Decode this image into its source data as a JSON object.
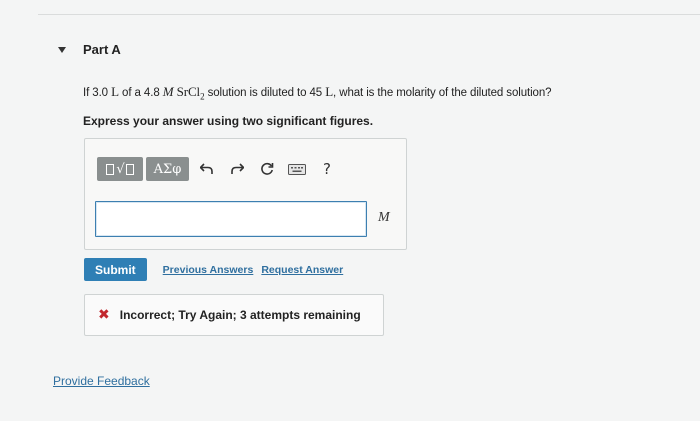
{
  "part": {
    "title": "Part A"
  },
  "question": {
    "prefix": "If 3.0",
    "unit_l1": "L",
    "text_of": "of a 4.8",
    "molar_symbol": "M",
    "compound": "SrCl",
    "compound_sub": "2",
    "text_diluted": "solution is diluted to 45",
    "unit_l2": "L",
    "suffix": ", what is the molarity of the diluted solution?"
  },
  "instructions": "Express your answer using two significant figures.",
  "toolbar": {
    "templates_radical": "√",
    "greek_label": "ΑΣφ",
    "help_label": "?"
  },
  "answer": {
    "value": "",
    "unit": "M"
  },
  "actions": {
    "submit_label": "Submit",
    "previous_answers_label": "Previous Answers",
    "request_answer_label": "Request Answer"
  },
  "feedback": {
    "icon": "✖",
    "message": "Incorrect; Try Again; 3 attempts remaining"
  },
  "footer": {
    "provide_feedback_label": "Provide Feedback"
  },
  "colors": {
    "accent": "#2f7fb5",
    "error": "#c2272d",
    "link": "#2f6f9f"
  }
}
